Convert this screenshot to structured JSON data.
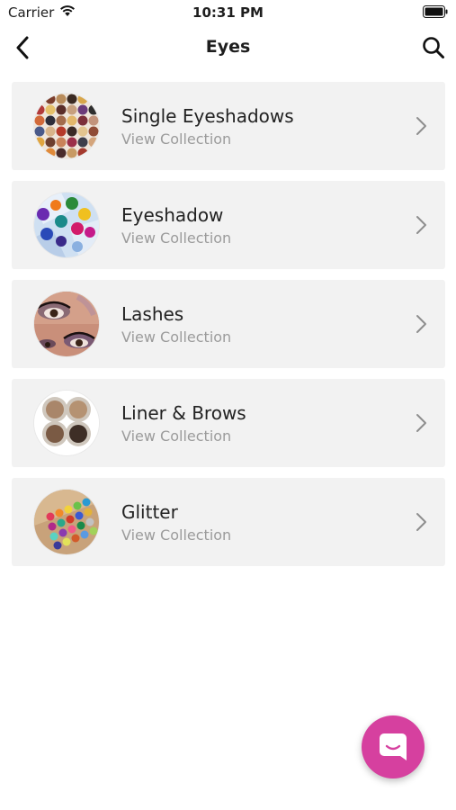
{
  "status_bar": {
    "carrier": "Carrier",
    "time": "10:31 PM"
  },
  "nav": {
    "title": "Eyes",
    "back_icon": "chevron-left-icon",
    "search_icon": "search-icon"
  },
  "collections": [
    {
      "title": "Single Eyeshadows",
      "subtitle": "View Collection",
      "thumb": "single-eyeshadows-thumbnail"
    },
    {
      "title": "Eyeshadow",
      "subtitle": "View Collection",
      "thumb": "eyeshadow-thumbnail"
    },
    {
      "title": "Lashes",
      "subtitle": "View Collection",
      "thumb": "lashes-thumbnail"
    },
    {
      "title": "Liner & Brows",
      "subtitle": "View Collection",
      "thumb": "liner-brows-thumbnail"
    },
    {
      "title": "Glitter",
      "subtitle": "View Collection",
      "thumb": "glitter-thumbnail"
    }
  ],
  "chat_button": {
    "icon": "chat-icon",
    "color": "#d6409f"
  },
  "colors": {
    "item_background": "#f2f2f2",
    "subtitle_text": "#9b9b9b",
    "chevron": "#8e8e8e"
  }
}
